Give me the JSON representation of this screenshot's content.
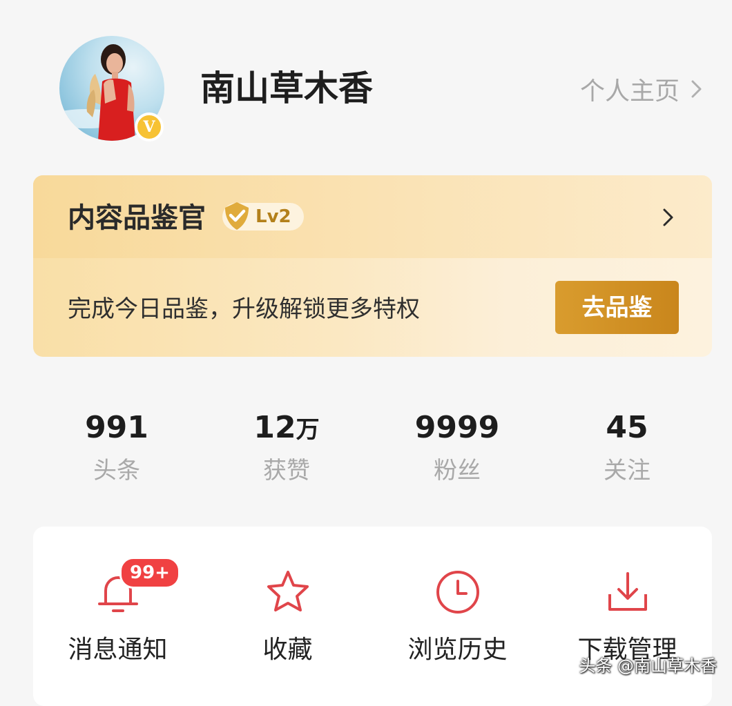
{
  "profile": {
    "username": "南山草木香",
    "verified_mark": "V",
    "profile_link": "个人主页"
  },
  "curator": {
    "title": "内容品鉴官",
    "level": "Lv2",
    "description": "完成今日品鉴，升级解锁更多特权",
    "button": "去品鉴"
  },
  "stats": [
    {
      "value": "991",
      "unit": "",
      "label": "头条"
    },
    {
      "value": "12",
      "unit": "万",
      "label": "获赞"
    },
    {
      "value": "9999",
      "unit": "",
      "label": "粉丝"
    },
    {
      "value": "45",
      "unit": "",
      "label": "关注"
    }
  ],
  "quick_actions": [
    {
      "label": "消息通知",
      "icon": "bell-icon",
      "badge": "99+"
    },
    {
      "label": "收藏",
      "icon": "star-icon"
    },
    {
      "label": "浏览历史",
      "icon": "clock-icon"
    },
    {
      "label": "下载管理",
      "icon": "download-icon"
    }
  ],
  "watermark": "头条 @南山草木香",
  "colors": {
    "accent_red": "#e0454a",
    "badge_red": "#f04142",
    "gold_button": "#cf8e22",
    "verified_yellow": "#f7c234"
  }
}
